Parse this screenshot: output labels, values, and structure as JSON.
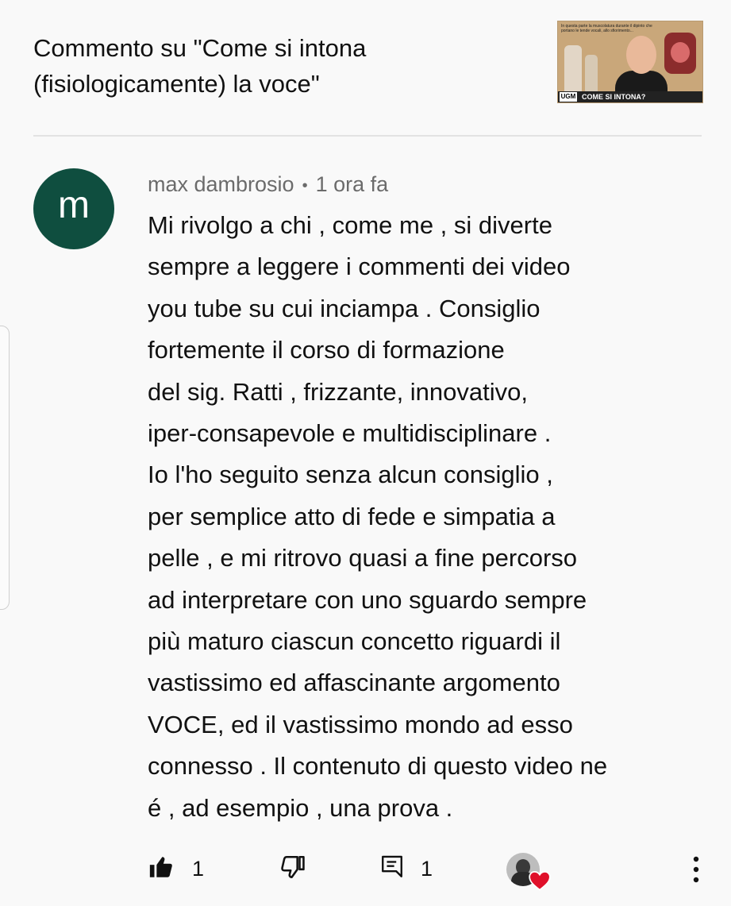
{
  "header": {
    "title_line1": "Commento su \"Come si intona",
    "title_line2": "(fisiologicamente) la voce\"",
    "thumbnail": {
      "caption": "COME SI INTONA?",
      "logo": "UGM",
      "small_text": "In questa parte la muscolatura durante il dipinto che portano le tende vocali, allo sfiorimento..."
    }
  },
  "comment": {
    "avatar_letter": "m",
    "avatar_color": "#0f4e3f",
    "author": "max dambrosio",
    "separator": "•",
    "time": "1 ora fa",
    "lines": [
      "Mi rivolgo a chi , come me , si diverte",
      "sempre a leggere i commenti dei video",
      "you tube su cui inciampa .  Consiglio",
      "fortemente il corso di formazione",
      "del sig. Ratti , frizzante, innovativo,",
      "iper-consapevole e  multidisciplinare .",
      "Io l'ho seguito senza alcun consiglio ,",
      "per semplice atto di fede e simpatia a",
      "pelle , e mi ritrovo quasi a fine percorso",
      "ad interpretare con uno sguardo sempre",
      "più maturo ciascun concetto riguardi il",
      "vastissimo ed affascinante argomento",
      "VOCE,  ed il vastissimo mondo ad esso",
      "connesso . Il contenuto di questo video ne",
      "é , ad esempio , una prova ."
    ]
  },
  "actions": {
    "like_count": "1",
    "reply_count": "1",
    "heart_color": "#e0102a"
  }
}
